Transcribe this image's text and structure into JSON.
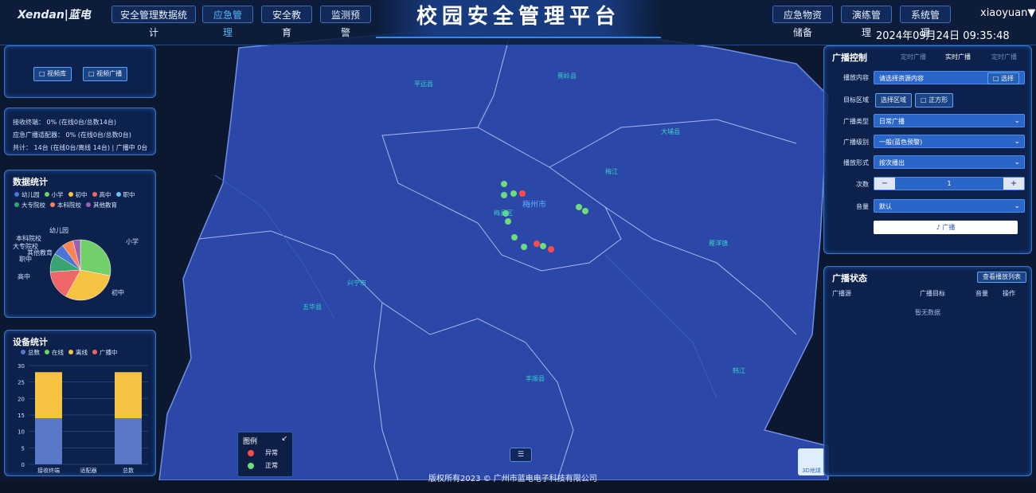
{
  "app": {
    "logo": "Xendan|蓝电",
    "title": "校园安全管理平台",
    "user": "xiaoyuan▼",
    "datetime": "2024年09月24日 09:35:48"
  },
  "nav_left": [
    {
      "label": "安全管理数据统计"
    },
    {
      "label": "应急管理"
    },
    {
      "label": "安全教育"
    },
    {
      "label": "监测预警"
    }
  ],
  "nav_right": [
    {
      "label": "应急物资储备"
    },
    {
      "label": "演练管理"
    },
    {
      "label": "系统管理"
    }
  ],
  "left_top": {
    "buttons": [
      {
        "label": "□ 视频库"
      },
      {
        "label": "□ 视频广播"
      }
    ]
  },
  "terminal_status": {
    "line1": "接收终端： 0% (在线0台/总数14台)",
    "line2": "应急广播适配器： 0% (在线0台/总数0台)",
    "line3": "共计： 14台 (在线0台/离线 14台) | 广播中 0台"
  },
  "data_stats": {
    "title": "数据统计",
    "legend": [
      {
        "label": "幼儿园",
        "color": "#4a74d8"
      },
      {
        "label": "小学",
        "color": "#72d06a"
      },
      {
        "label": "初中",
        "color": "#f5c242"
      },
      {
        "label": "高中",
        "color": "#ee6666"
      },
      {
        "label": "职中",
        "color": "#63c3f0"
      },
      {
        "label": "大专院校",
        "color": "#3ba272"
      },
      {
        "label": "本科院校",
        "color": "#fc8452"
      },
      {
        "label": "其他教育",
        "color": "#9a60b4"
      }
    ],
    "pie_labels": {
      "a": "幼儿园",
      "b": "小学",
      "c": "初中",
      "d": "高中",
      "e": "职中",
      "f": "大专院校",
      "g": "本科院校",
      "h": "其他教育"
    }
  },
  "chart_data": {
    "type": "bar",
    "title": "设备统计",
    "legend": [
      "总数",
      "在线",
      "离线",
      "广播中"
    ],
    "categories": [
      "接收终端",
      "适配器",
      "总数"
    ],
    "series": [
      {
        "name": "在线",
        "values": [
          14,
          0,
          14
        ],
        "color": "#5a78c8"
      },
      {
        "name": "离线",
        "values": [
          14,
          0,
          14
        ],
        "color": "#f5c242"
      }
    ],
    "yticks": [
      "0",
      "5",
      "10",
      "15",
      "20",
      "25",
      "30"
    ],
    "ylim": [
      0,
      30
    ]
  },
  "broadcast_control": {
    "title": "广播控制",
    "tabs": [
      {
        "label": "定时广播"
      },
      {
        "label": "实时广播"
      },
      {
        "label": "定时广播"
      }
    ],
    "content_label": "播放内容",
    "content_placeholder": "请选择资源内容",
    "content_btn": "□ 选择",
    "area_label": "目标区域",
    "area_btn1": "选择区域",
    "area_btn2": "□ 正方形",
    "type_label": "广播类型",
    "type_value": "日常广播",
    "level_label": "广播级别",
    "level_value": "一般(蓝色预警)",
    "mode_label": "播放形式",
    "mode_value": "按次播出",
    "count_label": "次数",
    "count_value": "1",
    "volume_label": "音量",
    "volume_value": "默认",
    "submit": "♪ 广播"
  },
  "broadcast_status": {
    "title": "广播状态",
    "btn": "查看播放列表",
    "headers": [
      "广播源",
      "广播目标",
      "音量",
      "操作"
    ],
    "empty": "暂无数据"
  },
  "map": {
    "city": "梅州市",
    "labels": [
      "梅县区",
      "兴宁市",
      "五华县",
      "丰顺县",
      "大埔县",
      "平远县",
      "蕉岭县",
      "雁洋镇",
      "梅江",
      "韩江"
    ],
    "legend_title": "图例",
    "legend_abnormal": "异常",
    "legend_normal": "正常",
    "copyright": "版权所有2023 © 广州市蓝电电子科技有限公司",
    "corner_badge": "3D地球"
  }
}
